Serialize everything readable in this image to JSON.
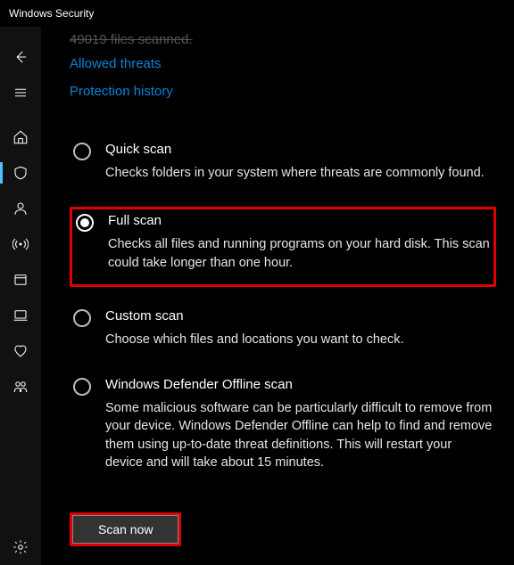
{
  "window": {
    "title": "Windows Security"
  },
  "top": {
    "truncated": "49019 files scanned.",
    "allowed_threats": "Allowed threats",
    "protection_history": "Protection history"
  },
  "options": {
    "quick": {
      "title": "Quick scan",
      "desc": "Checks folders in your system where threats are commonly found."
    },
    "full": {
      "title": "Full scan",
      "desc": "Checks all files and running programs on your hard disk. This scan could take longer than one hour."
    },
    "custom": {
      "title": "Custom scan",
      "desc": "Choose which files and locations you want to check."
    },
    "offline": {
      "title": "Windows Defender Offline scan",
      "desc": "Some malicious software can be particularly difficult to remove from your device. Windows Defender Offline can help to find and remove them using up-to-date threat definitions. This will restart your device and will take about 15 minutes."
    }
  },
  "selected_option": "full",
  "button": {
    "scan_now": "Scan now"
  }
}
